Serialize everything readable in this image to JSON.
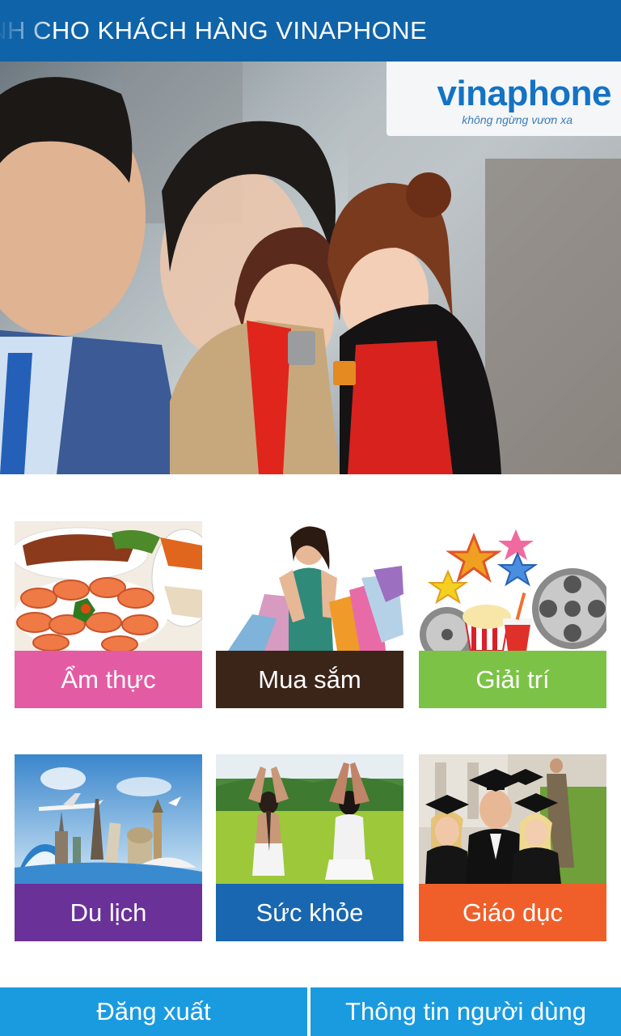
{
  "header": {
    "title": "DÀNH CHO KHÁCH HÀNG VINAPHONE",
    "color": "#0f63a8"
  },
  "hero": {
    "brand": "vinaphone",
    "slogan": "không ngừng vươn xa",
    "brand_color": "#1373c4"
  },
  "categories": [
    {
      "label": "Ẩm thực",
      "color": "#e35ca3",
      "icon": "food-icon"
    },
    {
      "label": "Mua sắm",
      "color": "#3b2518",
      "icon": "shopping-icon"
    },
    {
      "label": "Giải trí",
      "color": "#7cc246",
      "icon": "entertainment-icon"
    },
    {
      "label": "Du lịch",
      "color": "#6a3199",
      "icon": "travel-icon"
    },
    {
      "label": "Sức khỏe",
      "color": "#1867b0",
      "icon": "health-icon"
    },
    {
      "label": "Giáo dục",
      "color": "#f05f2a",
      "icon": "education-icon"
    }
  ],
  "bottom_bar": {
    "logout_label": "Đăng xuất",
    "user_info_label": "Thông tin người dùng",
    "color": "#1a9be0"
  }
}
